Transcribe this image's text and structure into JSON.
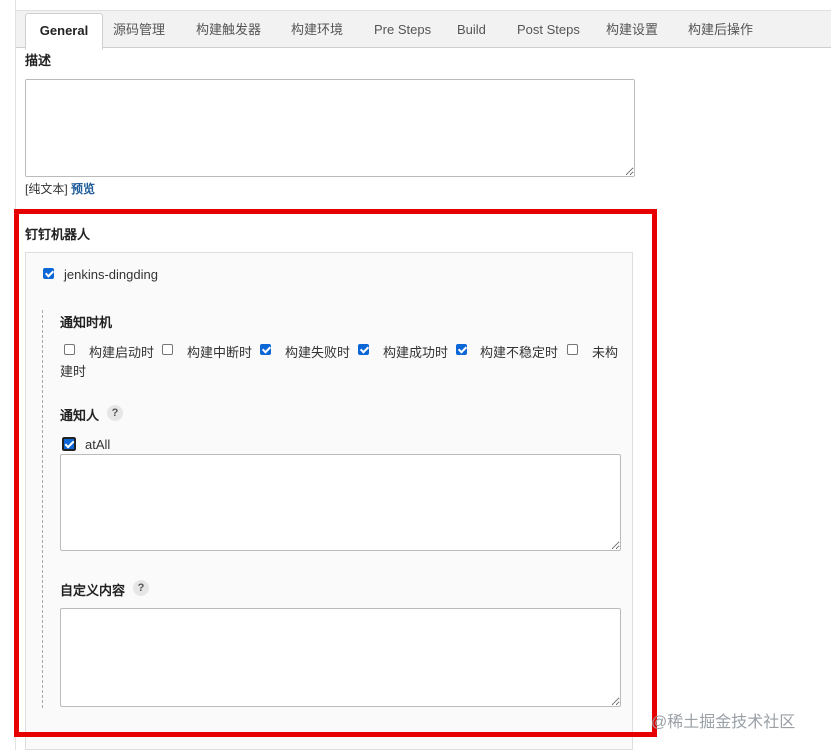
{
  "tabs": [
    {
      "label": "General",
      "active": true
    },
    {
      "label": "源码管理"
    },
    {
      "label": "构建触发器"
    },
    {
      "label": "构建环境"
    },
    {
      "label": "Pre Steps"
    },
    {
      "label": "Build"
    },
    {
      "label": "Post Steps"
    },
    {
      "label": "构建设置"
    },
    {
      "label": "构建后操作"
    }
  ],
  "general": {
    "description_label": "描述",
    "description_value": "",
    "plain_text_label": "[纯文本]",
    "preview_link": "预览"
  },
  "dingding": {
    "section_title": "钉钉机器人",
    "plugin_checkbox_label": "jenkins-dingding",
    "plugin_checked": true,
    "notify_timing_label": "通知时机",
    "timing_options": [
      {
        "label": "构建启动时",
        "checked": false
      },
      {
        "label": "构建中断时",
        "checked": false
      },
      {
        "label": "构建失败时",
        "checked": true
      },
      {
        "label": "构建成功时",
        "checked": true
      },
      {
        "label": "构建不稳定时",
        "checked": true
      },
      {
        "label_line1": "未构",
        "label_line2": "建时",
        "checked": false
      }
    ],
    "notify_people_label": "通知人",
    "help_symbol": "?",
    "at_all_label": "atAll",
    "at_all_checked": true,
    "notify_people_value": "",
    "custom_content_label": "自定义内容",
    "custom_content_value": ""
  },
  "colors": {
    "highlight_border": "#e60000",
    "checkbox_blue": "#0b66d6",
    "link_blue": "#1f5c99"
  },
  "watermark": "@稀土掘金技术社区"
}
